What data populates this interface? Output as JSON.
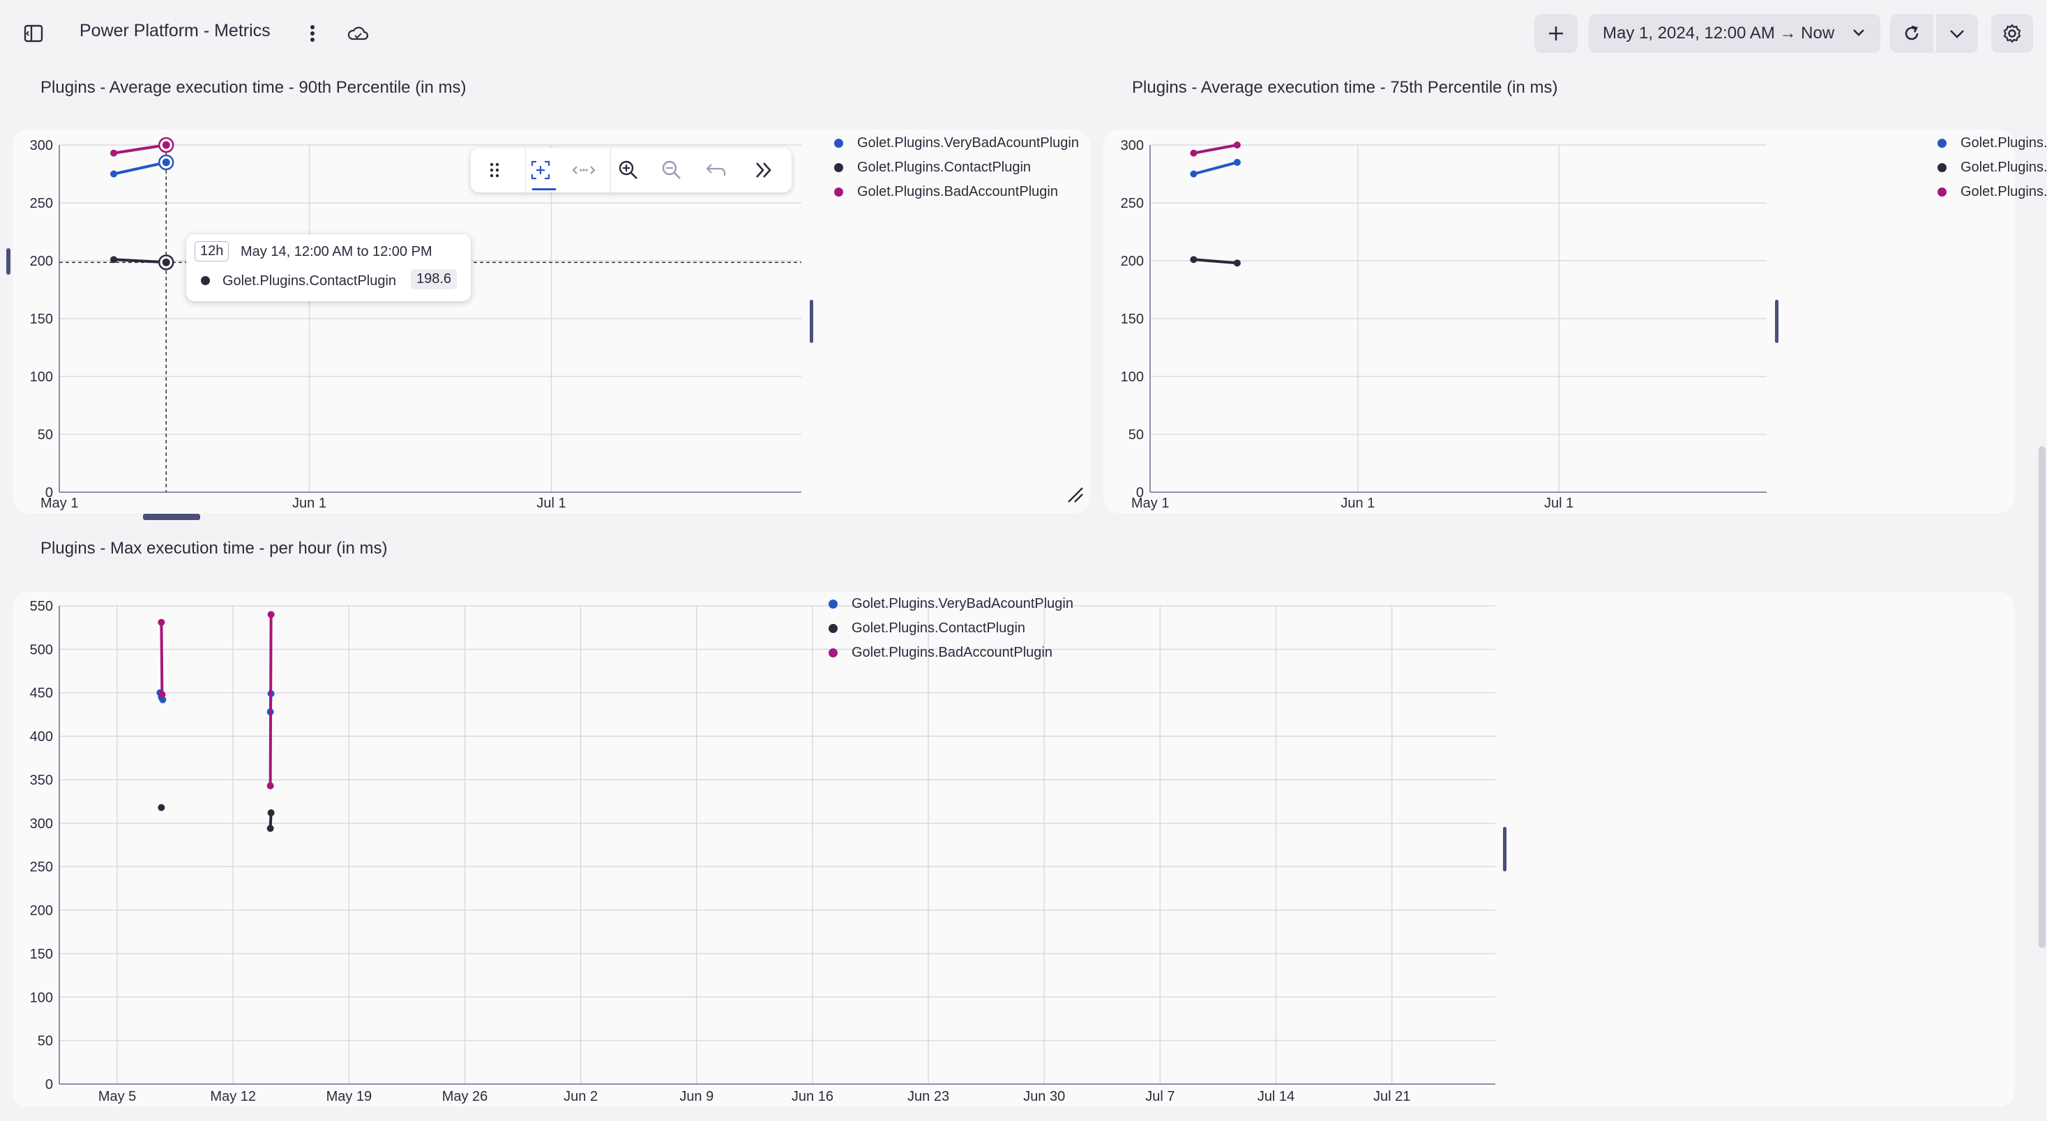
{
  "header": {
    "title": "Power Platform - Metrics",
    "timeframe": "May 1, 2024, 12:00 AM → Now",
    "icons": {
      "sidebar": "sidebar-toggle-icon",
      "more": "more-vertical-icon",
      "cloud": "cloud-icon",
      "add": "plus-icon",
      "chevron": "chevron-down-icon",
      "refresh": "refresh-icon",
      "settings": "gear-icon"
    }
  },
  "colors": {
    "VeryBad": "#2457c5",
    "Contact": "#2a2b3a",
    "Bad": "#a6177a",
    "grid": "#d9d9e3",
    "axis": "#8d8fa8",
    "handle": "#4b4f7a"
  },
  "tiles": {
    "p90": {
      "title": "Plugins - Average execution time - 90th Percentile (in ms)",
      "legend": [
        "Golet.Plugins.VeryBadAcountPlugin",
        "Golet.Plugins.ContactPlugin",
        "Golet.Plugins.BadAccountPlugin"
      ]
    },
    "p75": {
      "title": "Plugins - Average execution time - 75th Percentile (in ms)",
      "legend": [
        "Golet.Plugins...dAcountPlugin",
        "Golet.Plugins.ContactPlugin",
        "Golet.Plugins...AccountPlugin"
      ]
    },
    "max": {
      "title": "Plugins - Max execution time - per hour (in ms)",
      "legend": [
        "Golet.Plugins.VeryBadAcountPlugin",
        "Golet.Plugins.ContactPlugin",
        "Golet.Plugins.BadAccountPlugin"
      ]
    }
  },
  "toolbar": {
    "items": [
      "drag-handle-icon",
      "select-zoom-icon",
      "pan-icon",
      "zoom-in-icon",
      "zoom-out-icon",
      "undo-zoom-icon",
      "expand-icon"
    ]
  },
  "tooltip": {
    "resolution": "12h",
    "range": "May 14, 12:00 AM to 12:00 PM",
    "series": "Golet.Plugins.ContactPlugin",
    "value": "198.6"
  },
  "chart_data": [
    {
      "type": "line",
      "title": "Plugins - Average execution time - 90th Percentile (in ms)",
      "ylim": [
        0,
        300
      ],
      "yticks": [
        0,
        50,
        100,
        150,
        200,
        250,
        300
      ],
      "xlim": [
        "2024-05-01",
        "2024-08-01"
      ],
      "xticks": [
        {
          "date": "2024-05-01",
          "label": "May 1"
        },
        {
          "date": "2024-06-01",
          "label": "Jun 1"
        },
        {
          "date": "2024-07-01",
          "label": "Jul 1"
        }
      ],
      "crosshair": {
        "x": "2024-05-14T06:00",
        "y": 198.6
      },
      "series": [
        {
          "name": "Golet.Plugins.VeryBadAcountPlugin",
          "color": "VeryBad",
          "points": [
            [
              "2024-05-07T18:00",
              275
            ],
            [
              "2024-05-14T06:00",
              285
            ]
          ]
        },
        {
          "name": "Golet.Plugins.ContactPlugin",
          "color": "Contact",
          "points": [
            [
              "2024-05-07T18:00",
              201
            ],
            [
              "2024-05-14T06:00",
              198.6
            ]
          ]
        },
        {
          "name": "Golet.Plugins.BadAccountPlugin",
          "color": "Bad",
          "points": [
            [
              "2024-05-07T18:00",
              293
            ],
            [
              "2024-05-14T06:00",
              300
            ]
          ]
        }
      ]
    },
    {
      "type": "line",
      "title": "Plugins - Average execution time - 75th Percentile (in ms)",
      "ylim": [
        0,
        300
      ],
      "yticks": [
        0,
        50,
        100,
        150,
        200,
        250,
        300
      ],
      "xlim": [
        "2024-05-01",
        "2024-08-01"
      ],
      "xticks": [
        {
          "date": "2024-05-01",
          "label": "May 1"
        },
        {
          "date": "2024-06-01",
          "label": "Jun 1"
        },
        {
          "date": "2024-07-01",
          "label": "Jul 1"
        }
      ],
      "series": [
        {
          "name": "Golet.Plugins...dAcountPlugin",
          "color": "VeryBad",
          "points": [
            [
              "2024-05-07T12:00",
              275
            ],
            [
              "2024-05-14T00:00",
              285
            ]
          ]
        },
        {
          "name": "Golet.Plugins.ContactPlugin",
          "color": "Contact",
          "points": [
            [
              "2024-05-07T12:00",
              201
            ],
            [
              "2024-05-14T00:00",
              198
            ]
          ]
        },
        {
          "name": "Golet.Plugins...AccountPlugin",
          "color": "Bad",
          "points": [
            [
              "2024-05-07T12:00",
              293
            ],
            [
              "2024-05-14T00:00",
              300
            ]
          ]
        }
      ]
    },
    {
      "type": "line",
      "title": "Plugins - Max execution time - per hour (in ms)",
      "ylim": [
        0,
        550
      ],
      "yticks": [
        0,
        50,
        100,
        150,
        200,
        250,
        300,
        350,
        400,
        450,
        500,
        550
      ],
      "xlim": [
        "2024-05-01T12:00",
        "2024-07-27T06:00"
      ],
      "xticks": [
        {
          "date": "2024-05-05",
          "label": "May 5"
        },
        {
          "date": "2024-05-12",
          "label": "May 12"
        },
        {
          "date": "2024-05-19",
          "label": "May 19"
        },
        {
          "date": "2024-05-26",
          "label": "May 26"
        },
        {
          "date": "2024-06-02",
          "label": "Jun 2"
        },
        {
          "date": "2024-06-09",
          "label": "Jun 9"
        },
        {
          "date": "2024-06-16",
          "label": "Jun 16"
        },
        {
          "date": "2024-06-23",
          "label": "Jun 23"
        },
        {
          "date": "2024-06-30",
          "label": "Jun 30"
        },
        {
          "date": "2024-07-07",
          "label": "Jul 7"
        },
        {
          "date": "2024-07-14",
          "label": "Jul 14"
        },
        {
          "date": "2024-07-21",
          "label": "Jul 21"
        }
      ],
      "series": [
        {
          "name": "Golet.Plugins.VeryBadAcountPlugin",
          "color": "VeryBad",
          "segments": [
            [
              [
                "2024-05-07T14:00",
                450
              ],
              [
                "2024-05-07T16:00",
                445
              ],
              [
                "2024-05-07T18:00",
                442
              ]
            ],
            [
              [
                "2024-05-14T06:00",
                428
              ],
              [
                "2024-05-14T07:00",
                449
              ]
            ]
          ]
        },
        {
          "name": "Golet.Plugins.ContactPlugin",
          "color": "Contact",
          "segments": [
            [
              [
                "2024-05-07T16:00",
                318
              ]
            ],
            [
              [
                "2024-05-14T06:00",
                294
              ],
              [
                "2024-05-14T07:00",
                312
              ]
            ]
          ]
        },
        {
          "name": "Golet.Plugins.BadAccountPlugin",
          "color": "Bad",
          "segments": [
            [
              [
                "2024-05-07T16:00",
                531
              ],
              [
                "2024-05-07T17:00",
                448
              ]
            ],
            [
              [
                "2024-05-14T06:00",
                343
              ],
              [
                "2024-05-14T07:00",
                540
              ]
            ]
          ]
        }
      ]
    }
  ]
}
